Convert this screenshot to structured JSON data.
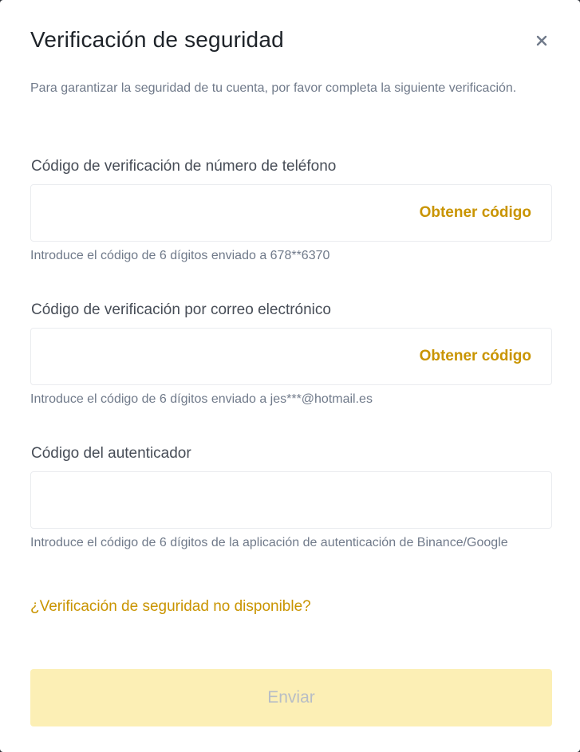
{
  "dialog": {
    "title": "Verificación de seguridad",
    "subtitle": "Para garantizar la seguridad de tu cuenta, por favor completa la siguiente verificación.",
    "close_icon": "close-icon"
  },
  "fields": {
    "phone": {
      "label": "Código de verificación de número de teléfono",
      "value": "",
      "placeholder": "",
      "action_label": "Obtener código",
      "hint": "Introduce el código de 6 dígitos enviado a 678**6370"
    },
    "email": {
      "label": "Código de verificación por correo electrónico",
      "value": "",
      "placeholder": "",
      "action_label": "Obtener código",
      "hint": "Introduce el código de 6 dígitos enviado a jes***@hotmail.es"
    },
    "authenticator": {
      "label": "Código del autenticador",
      "value": "",
      "placeholder": "",
      "hint": "Introduce el código de 6 dígitos de la aplicación de autenticación de Binance/Google"
    }
  },
  "links": {
    "unavailable": "¿Verificación de seguridad no disponible?"
  },
  "actions": {
    "submit_label": "Enviar",
    "submit_enabled": false
  },
  "colors": {
    "accent": "#c99400",
    "submit_disabled_bg": "#fcefb5",
    "text_primary": "#1e2329",
    "text_secondary": "#707a8a"
  }
}
